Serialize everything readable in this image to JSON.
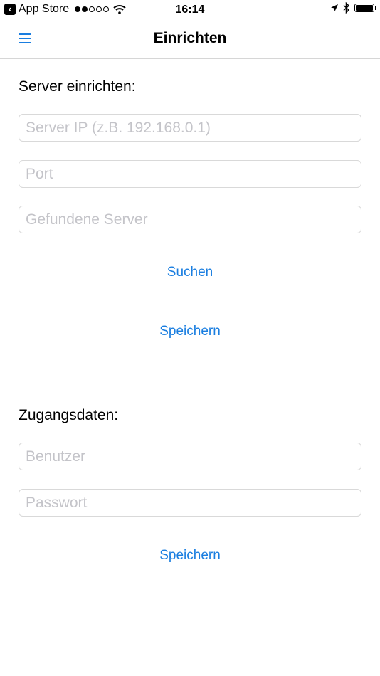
{
  "status_bar": {
    "back_app": "App Store",
    "time": "16:14",
    "signal_filled": 2,
    "signal_total": 5,
    "battery_level": 1.0
  },
  "nav": {
    "title": "Einrichten",
    "menu_icon": "hamburger-menu-icon"
  },
  "server_section": {
    "title": "Server einrichten:",
    "server_ip_placeholder": "Server IP (z.B. 192.168.0.1)",
    "port_placeholder": "Port",
    "found_servers_placeholder": "Gefundene Server",
    "search_label": "Suchen",
    "save_label": "Speichern"
  },
  "credentials_section": {
    "title": "Zugangsdaten:",
    "user_placeholder": "Benutzer",
    "password_placeholder": "Passwort",
    "save_label": "Speichern"
  },
  "colors": {
    "accent": "#1a7ee0",
    "placeholder": "#c4c4c9",
    "border": "#d9d9d9"
  }
}
